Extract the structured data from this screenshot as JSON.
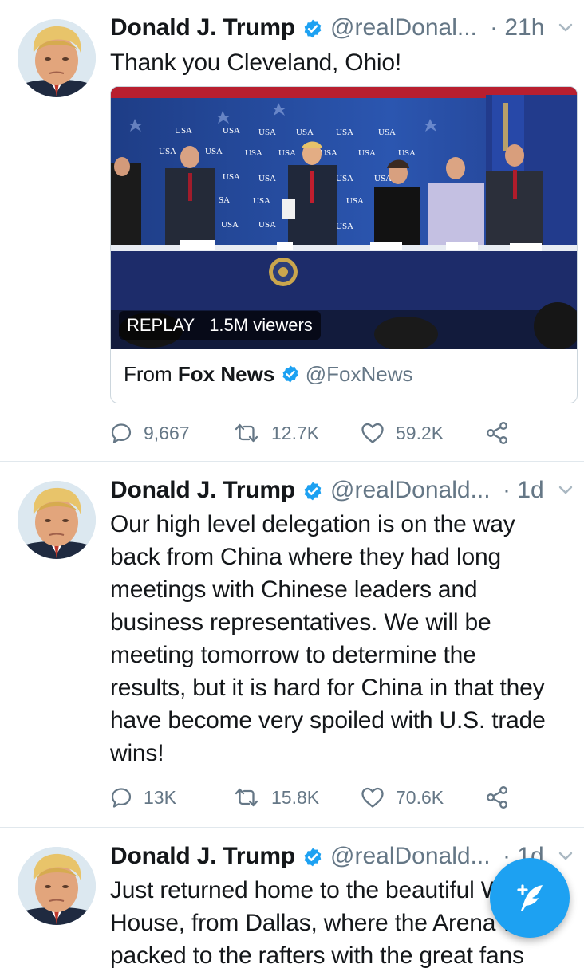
{
  "tweets": [
    {
      "name": "Donald J. Trump",
      "handle": "@realDonal...",
      "time": "· 21h",
      "text": "Thank you Cleveland, Ohio!",
      "media": {
        "replay_label": "REPLAY",
        "viewers": "1.5M viewers",
        "from_label": "From",
        "from_name": "Fox News",
        "from_handle": "@FoxNews"
      },
      "replies": "9,667",
      "retweets": "12.7K",
      "likes": "59.2K"
    },
    {
      "name": "Donald J. Trump",
      "handle": "@realDonald...",
      "time": "· 1d",
      "text_lines": [
        "Our high level delegation is on the way",
        "back from China where they had long",
        "meetings with Chinese leaders and",
        "business representatives. We will be",
        "meeting tomorrow to determine the",
        "results, but it is hard for China in that they",
        "have become very spoiled with U.S. trade",
        "wins!"
      ],
      "replies": "13K",
      "retweets": "15.8K",
      "likes": "70.6K"
    },
    {
      "name": "Donald J. Trump",
      "handle": "@realDonald...",
      "time": "· 1d",
      "text_lines": [
        "Just returned home to the beautiful White",
        "House, from Dallas, where the Arena was",
        "packed to the rafters with the great fans"
      ]
    }
  ],
  "colors": {
    "accent": "#1da1f2",
    "muted": "#657786",
    "divider": "#e1e8ed"
  },
  "icons": [
    "verified-badge-icon",
    "chevron-down-icon",
    "reply-icon",
    "retweet-icon",
    "like-icon",
    "share-icon",
    "compose-tweet-icon"
  ]
}
